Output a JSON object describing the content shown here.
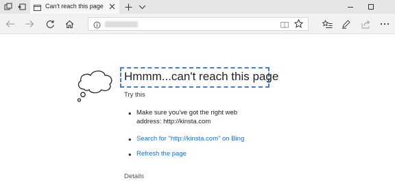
{
  "tab": {
    "title": "Can't reach this page"
  },
  "error": {
    "headline": "Hmmm...can't reach this page",
    "try_this": "Try this",
    "suggestion_line1": "Make sure you've got the right web",
    "suggestion_line2": "address: http://kinsta.com",
    "search_link": "Search for \"http://kinsta.com\" on Bing",
    "refresh_link": "Refresh the page",
    "details": "Details"
  },
  "colors": {
    "link": "#1a6fc9",
    "highlight_border": "#3b7dd8",
    "tabstrip": "#e6e6e6",
    "navbar": "#f2f2f2"
  },
  "icons": [
    "tab-preview-icon",
    "set-aside-tabs-icon",
    "page-icon",
    "close-tab-icon",
    "new-tab-icon",
    "tab-list-chevron-icon",
    "minimize-icon",
    "maximize-icon",
    "back-icon",
    "forward-icon",
    "refresh-icon",
    "home-icon",
    "info-icon",
    "reading-view-icon",
    "favorite-star-icon",
    "favorites-hub-icon",
    "web-note-icon",
    "share-icon",
    "more-icon",
    "thought-cloud-icon"
  ]
}
